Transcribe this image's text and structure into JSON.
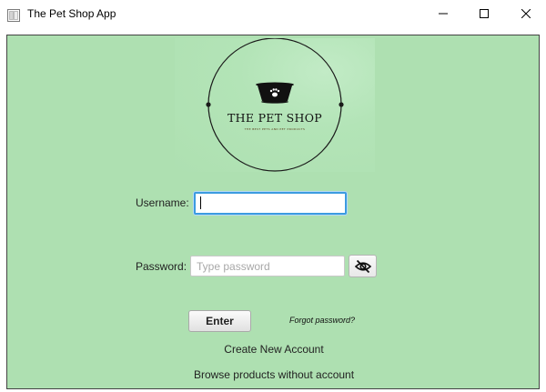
{
  "window": {
    "title": "The Pet Shop App"
  },
  "logo": {
    "title": "THE PET SHOP",
    "tagline": "THE BEST PETS AND PET PRODUCTS",
    "colors": {
      "ring": "#1a1a1a",
      "bowl": "#111111",
      "paw": "#ffffff"
    }
  },
  "form": {
    "username_label": "Username:",
    "username_value": "",
    "password_label": "Password:",
    "password_placeholder": "Type password",
    "password_value": "",
    "toggle_icon": "eye-slash-icon",
    "enter_label": "Enter",
    "forgot_label": "Forgot password?"
  },
  "links": {
    "create_account": "Create New Account",
    "browse": "Browse products without account"
  },
  "colors": {
    "background": "#aee0b1",
    "focus_border": "#3c9be0"
  }
}
